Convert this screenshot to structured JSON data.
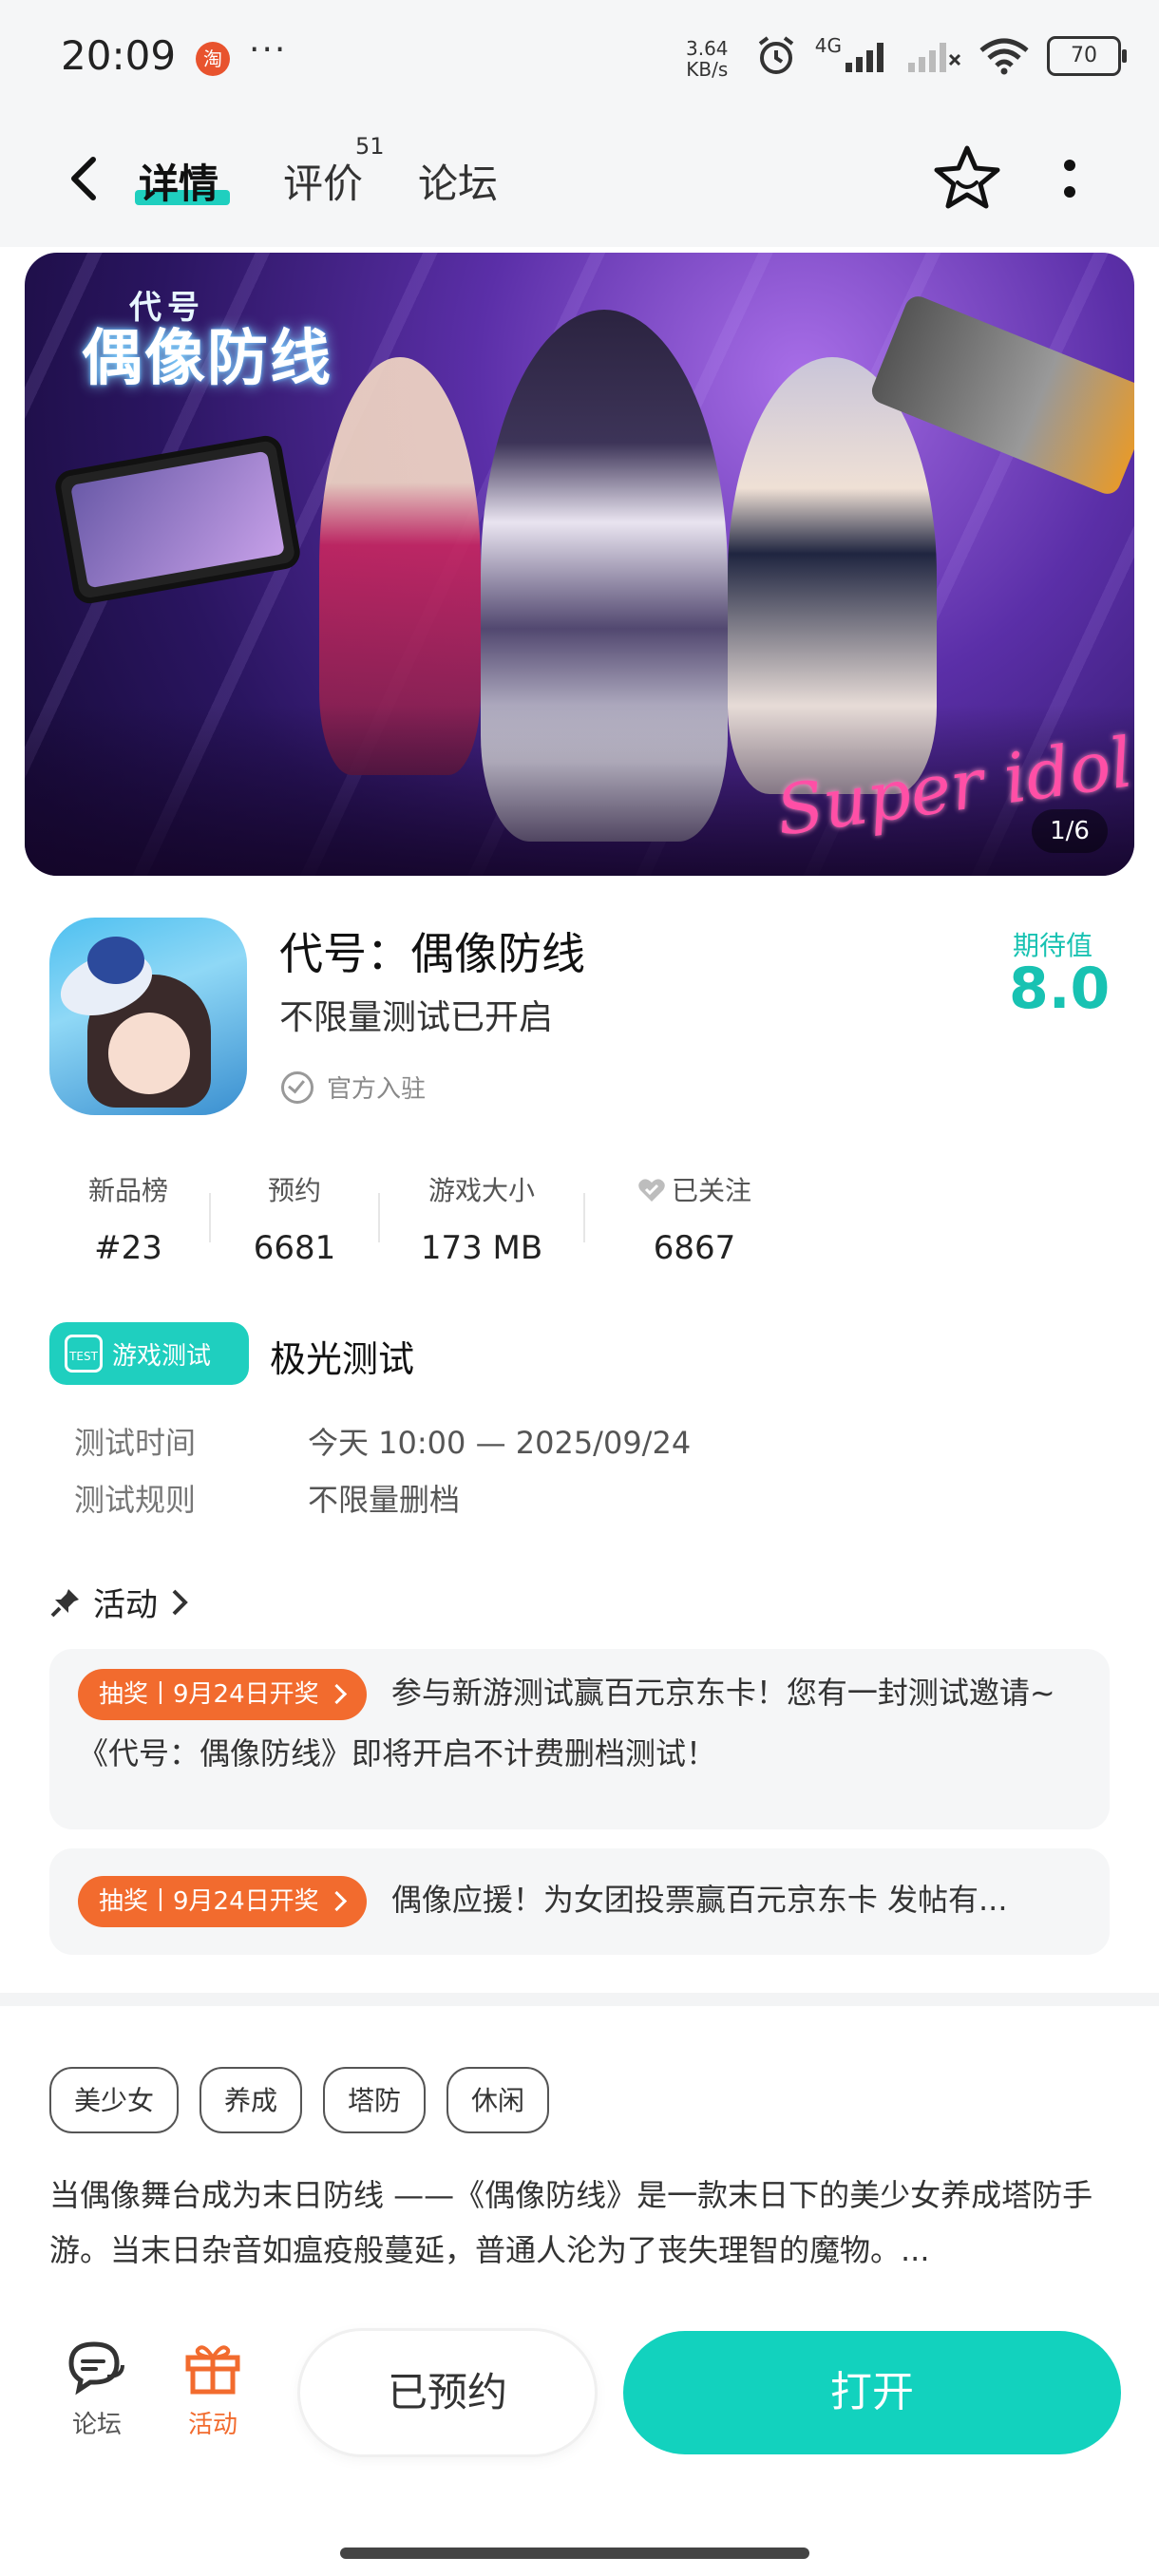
{
  "status_bar": {
    "time": "20:09",
    "app_icon_char": "淘",
    "dots": "···",
    "speed_value": "3.64",
    "speed_unit": "KB/s",
    "network": "4G",
    "battery": "70"
  },
  "header": {
    "tabs": [
      {
        "label": "详情"
      },
      {
        "label": "评价"
      },
      {
        "label": "论坛"
      }
    ],
    "review_count": "51",
    "accent_color": "#1fcfbf"
  },
  "banner": {
    "logo_small": "代号",
    "logo_title": "偶像防线",
    "script_text": "Super idol",
    "counter": "1/6"
  },
  "app": {
    "name": "代号：偶像防线",
    "subtitle": "不限量测试已开启",
    "verified_label": "官方入驻",
    "expect_label": "期待值",
    "expect_value": "8.0"
  },
  "stats": [
    {
      "label": "新品榜",
      "value": "#23"
    },
    {
      "label": "预约",
      "value": "6681"
    },
    {
      "label": "游戏大小",
      "value": "173 MB"
    },
    {
      "label": "已关注",
      "value": "6867"
    }
  ],
  "test": {
    "badge": "游戏测试",
    "badge_icon_text": "TEST",
    "name": "极光测试",
    "rows": [
      {
        "label": "测试时间",
        "value": "今天 10:00 — 2025/09/24"
      },
      {
        "label": "测试规则",
        "value": "不限量删档"
      }
    ]
  },
  "activities": {
    "title": "活动",
    "items": [
      {
        "tag": "抽奖丨9月24日开奖",
        "text": "参与新游测试赢百元京东卡！您有一封测试邀请~《代号：偶像防线》即将开启不计费删档测试！"
      },
      {
        "tag": "抽奖丨9月24日开奖",
        "text": "偶像应援！为女团投票赢百元京东卡 发帖有..."
      }
    ]
  },
  "tags": [
    "美少女",
    "养成",
    "塔防",
    "休闲"
  ],
  "description": "当偶像舞台成为末日防线 ——《偶像防线》是一款末日下的美少女养成塔防手游。当末日杂音如瘟疫般蔓延，普通人沦为了丧失理智的魔物。...",
  "bottom_bar": {
    "forum_label": "论坛",
    "activity_label": "活动",
    "reserved_label": "已预约",
    "open_label": "打开",
    "open_color": "#12d2be",
    "activity_color": "#f26b2e"
  }
}
